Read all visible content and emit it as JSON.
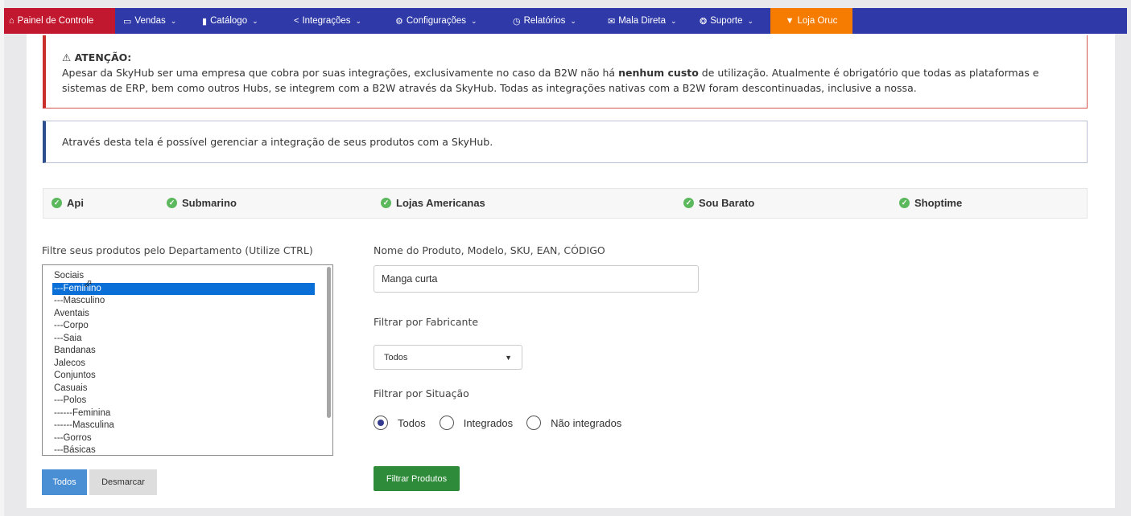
{
  "navbar": {
    "items": [
      {
        "label": "Painel de Controle",
        "icon": "home-icon"
      },
      {
        "label": "Vendas",
        "icon": "folder-icon"
      },
      {
        "label": "Catálogo",
        "icon": "book-icon"
      },
      {
        "label": "Integrações",
        "icon": "share-icon"
      },
      {
        "label": "Configurações",
        "icon": "gear-icon"
      },
      {
        "label": "Relatórios",
        "icon": "clock-icon"
      },
      {
        "label": "Mala Direta",
        "icon": "mail-icon"
      },
      {
        "label": "Suporte",
        "icon": "lifebuoy-icon"
      },
      {
        "label": "Loja Oruc",
        "icon": "store-icon"
      }
    ],
    "colors": {
      "bar": "#2f3aa8",
      "home": "#c2182f",
      "store": "#f57c00"
    }
  },
  "alert": {
    "title": "ATENÇÃO:",
    "text_before": "Apesar da SkyHub ser uma empresa que cobra por suas integrações, exclusivamente no caso da B2W não há ",
    "text_bold": "nenhum custo",
    "text_after": " de utilização. Atualmente é obrigatório que todas as plataformas e sistemas de ERP, bem como outros Hubs, se integrem com a B2W através da SkyHub. Todas as integrações nativas com a B2W foram descontinuadas, inclusive a nossa."
  },
  "info": {
    "text": "Através desta tela é possível gerenciar a integração de seus produtos com a SkyHub."
  },
  "statuses": [
    {
      "label": "Api"
    },
    {
      "label": "Submarino"
    },
    {
      "label": "Lojas Americanas"
    },
    {
      "label": "Sou Barato"
    },
    {
      "label": "Shoptime"
    }
  ],
  "department_filter": {
    "label": "Filtre seus produtos pelo Departamento (Utilize CTRL)",
    "options": [
      "Sociais",
      "---Feminino",
      "---Masculino",
      "Aventais",
      "---Corpo",
      "---Saia",
      "Bandanas",
      "Jalecos",
      "Conjuntos",
      "Casuais",
      "---Polos",
      "------Feminina",
      "------Masculina",
      "---Gorros",
      "---Básicas"
    ],
    "selected": "---Feminino",
    "todos_label": "Todos",
    "desmarcar_label": "Desmarcar"
  },
  "product_search": {
    "label": "Nome do Produto, Modelo, SKU, EAN, CÓDIGO",
    "value": "Manga curta"
  },
  "manufacturer_filter": {
    "label": "Filtrar por Fabricante",
    "selected": "Todos"
  },
  "situation_filter": {
    "label": "Filtrar por Situação",
    "options": [
      {
        "label": "Todos",
        "checked": true
      },
      {
        "label": "Integrados",
        "checked": false
      },
      {
        "label": "Não integrados",
        "checked": false
      }
    ]
  },
  "filter_button": {
    "label": "Filtrar Produtos"
  }
}
